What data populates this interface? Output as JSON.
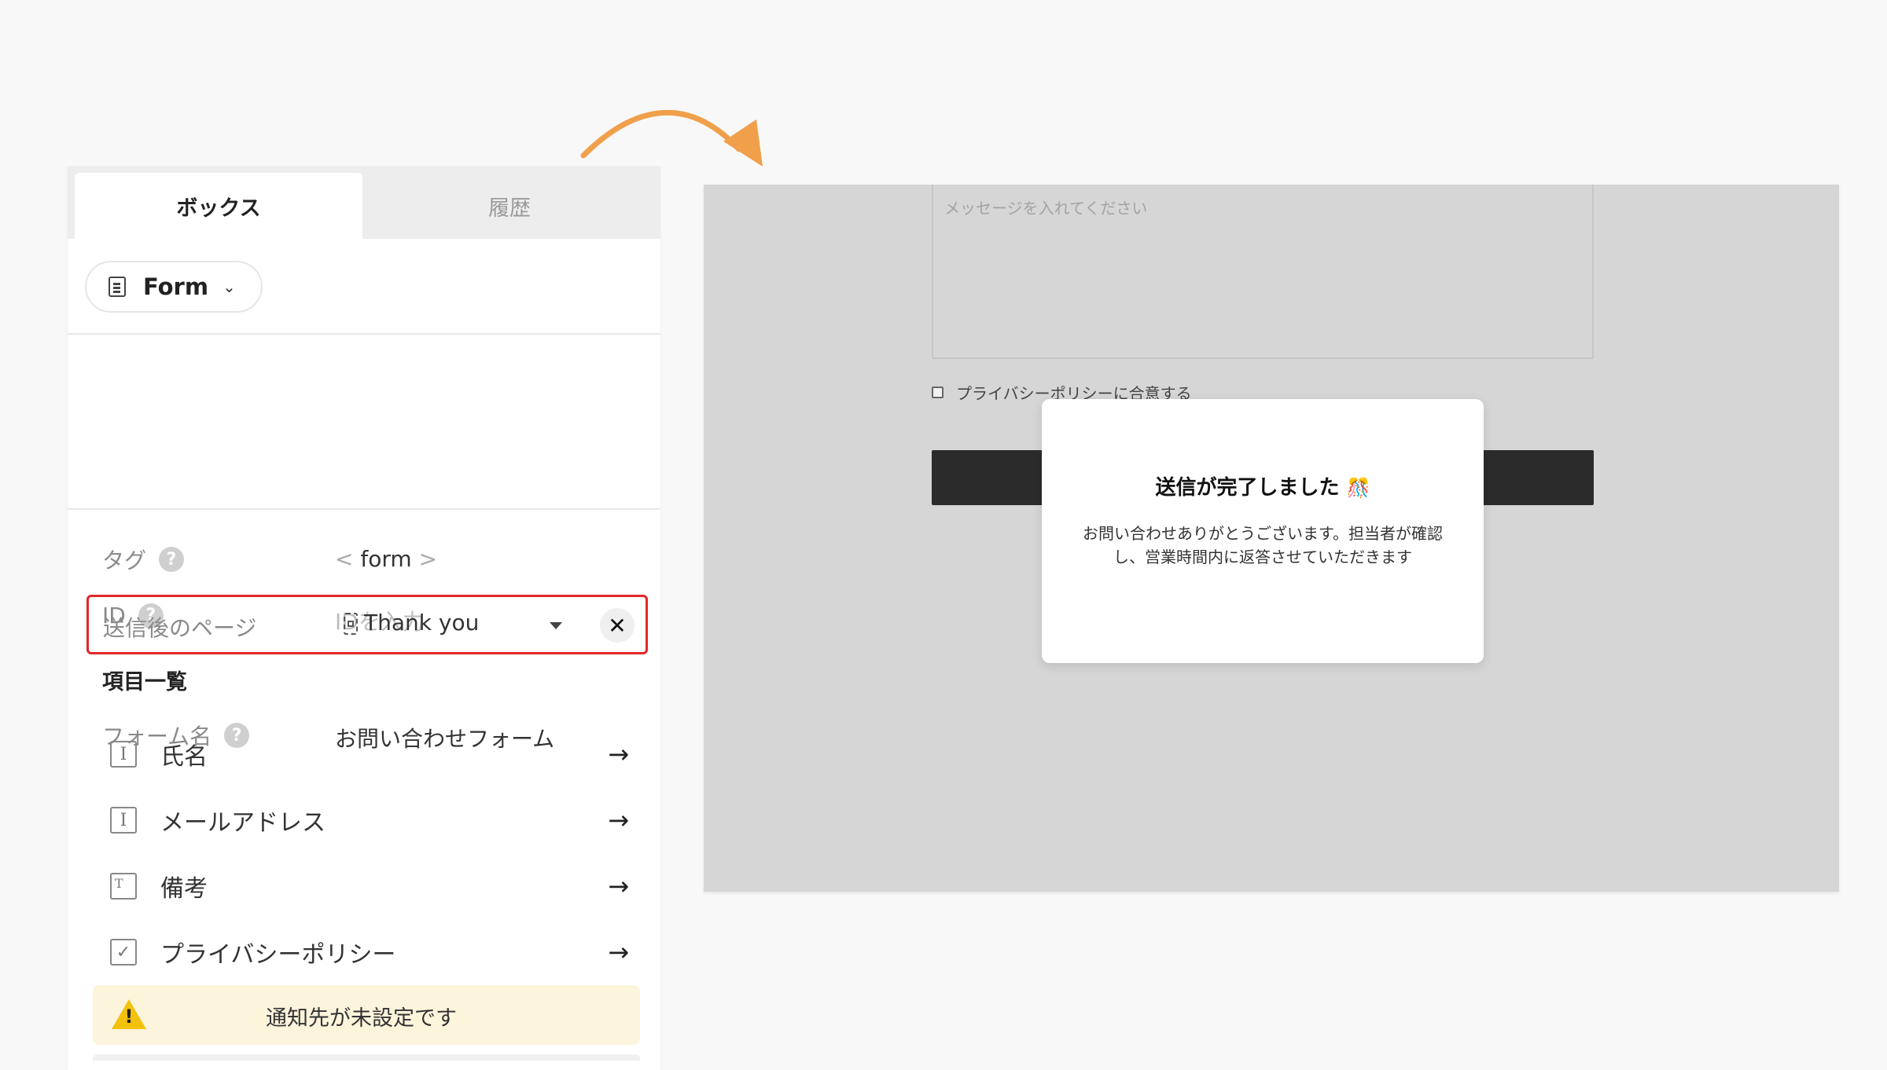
{
  "panel": {
    "tabs": [
      {
        "label": "ボックス",
        "active": true
      },
      {
        "label": "履歴",
        "active": false
      }
    ],
    "component_chip": {
      "label": "Form",
      "icon": "form-icon"
    },
    "properties": {
      "tag": {
        "label": "タグ",
        "value_open": "<",
        "value": "form",
        "value_close": ">"
      },
      "id": {
        "label": "ID",
        "placeholder": "IDを入力"
      }
    },
    "form_settings": {
      "form_name": {
        "label": "フォーム名",
        "value": "お問い合わせフォーム"
      },
      "after_submit_page": {
        "label": "送信後のページ",
        "value": "Thank you"
      }
    },
    "items_section": {
      "title": "項目一覧",
      "items": [
        {
          "label": "氏名",
          "icon": "text-field-icon"
        },
        {
          "label": "メールアドレス",
          "icon": "text-field-icon"
        },
        {
          "label": "備考",
          "icon": "textarea-icon"
        },
        {
          "label": "プライバシーポリシー",
          "icon": "checkbox-icon"
        }
      ]
    },
    "warning": {
      "text": "通知先が未設定です",
      "icon": "warning-icon"
    }
  },
  "preview": {
    "textarea_placeholder": "メッセージを入れてください",
    "privacy_label": "プライバシーポリシーに合意する",
    "modal": {
      "title": "送信が完了しました",
      "title_emoji": "🎊",
      "body": "お問い合わせありがとうございます。担当者が確認し、営業時間内に返答させていただきます"
    }
  },
  "colors": {
    "highlight_border": "#e32727",
    "arrow": "#f0a04b",
    "warning_bg": "#fdf4dc",
    "submit_button": "#2b2b2b"
  }
}
